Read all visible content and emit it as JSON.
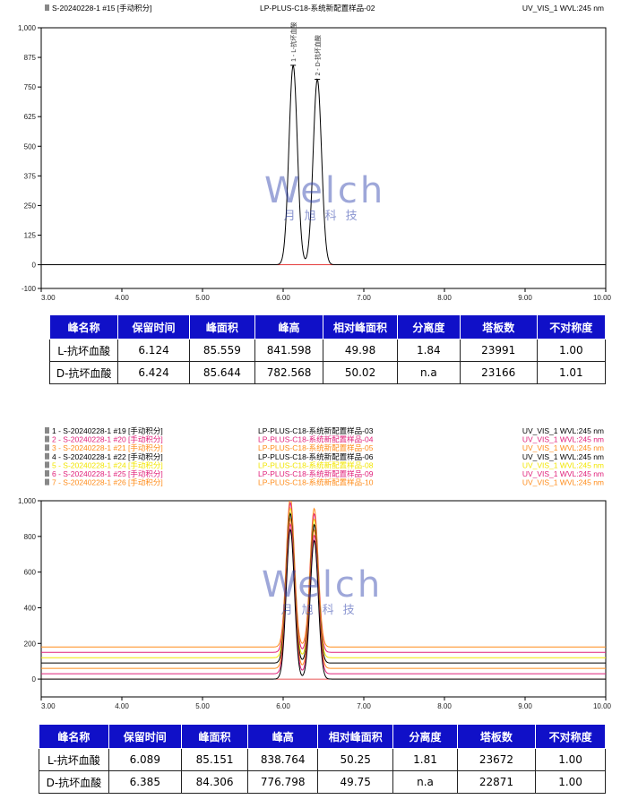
{
  "watermark": {
    "logo": "Welch",
    "subtitle": "月旭科技"
  },
  "colors": {
    "table_header_bg": "#1010c8",
    "baseline": "#e02020"
  },
  "panels": [
    {
      "header_rows": [
        {
          "color": "#000000",
          "left": "S-20240228-1 #15 [手动积分]",
          "mid": "LP-PLUS-C18-系统新配置样品-02",
          "right": "UV_VIS_1 WVL:245 nm"
        }
      ],
      "table": {
        "columns": [
          "峰名称",
          "保留时间",
          "峰面积",
          "峰高",
          "相对峰面积",
          "分离度",
          "塔板数",
          "不对称度"
        ],
        "rows": [
          [
            "L-抗坏血酸",
            "6.124",
            "85.559",
            "841.598",
            "49.98",
            "1.84",
            "23991",
            "1.00"
          ],
          [
            "D-抗坏血酸",
            "6.424",
            "85.644",
            "782.568",
            "50.02",
            "n.a",
            "23166",
            "1.01"
          ]
        ]
      }
    },
    {
      "header_rows": [
        {
          "color": "#000000",
          "left": "1 - S-20240228-1 #19 [手动积分]",
          "mid": "LP-PLUS-C18-系统新配置样品-03",
          "right": "UV_VIS_1 WVL:245 nm"
        },
        {
          "color": "#e0207a",
          "left": "2 - S-20240228-1 #20 [手动积分]",
          "mid": "LP-PLUS-C18-系统新配置样品-04",
          "right": "UV_VIS_1 WVL:245 nm"
        },
        {
          "color": "#ff8c1a",
          "left": "3 - S-20240228-1 #21 [手动积分]",
          "mid": "LP-PLUS-C18-系统新配置样品-05",
          "right": "UV_VIS_1 WVL:245 nm"
        },
        {
          "color": "#000000",
          "left": "4 - S-20240228-1 #22 [手动积分]",
          "mid": "LP-PLUS-C18-系统新配置样品-06",
          "right": "UV_VIS_1 WVL:245 nm"
        },
        {
          "color": "#f2e600",
          "left": "5 - S-20240228-1 #24 [手动积分]",
          "mid": "LP-PLUS-C18-系统新配置样品-08",
          "right": "UV_VIS_1 WVL:245 nm"
        },
        {
          "color": "#e0207a",
          "left": "6 - S-20240228-1 #25 [手动积分]",
          "mid": "LP-PLUS-C18-系统新配置样品-09",
          "right": "UV_VIS_1 WVL:245 nm"
        },
        {
          "color": "#ff8c1a",
          "left": "7 - S-20240228-1 #26 [手动积分]",
          "mid": "LP-PLUS-C18-系统新配置样品-10",
          "right": "UV_VIS_1 WVL:245 nm"
        }
      ],
      "table": {
        "columns": [
          "峰名称",
          "保留时间",
          "峰面积",
          "峰高",
          "相对峰面积",
          "分离度",
          "塔板数",
          "不对称度"
        ],
        "rows": [
          [
            "L-抗坏血酸",
            "6.089",
            "85.151",
            "838.764",
            "50.25",
            "1.81",
            "23672",
            "1.00"
          ],
          [
            "D-抗坏血酸",
            "6.385",
            "84.306",
            "776.798",
            "49.75",
            "n.a",
            "22871",
            "1.00"
          ]
        ]
      }
    }
  ],
  "chart_data": [
    {
      "type": "line",
      "title": "LP-PLUS-C18-系统新配置样品-02",
      "xlim": [
        3.0,
        10.0
      ],
      "ylim": [
        -100,
        1000
      ],
      "xticks": [
        "3.00",
        "4.00",
        "5.00",
        "6.00",
        "7.00",
        "8.00",
        "9.00",
        "10.00"
      ],
      "yticks": [
        "1,000",
        "875",
        "750",
        "625",
        "500",
        "375",
        "250",
        "125",
        "0",
        "-100"
      ],
      "ytick_values": [
        1000,
        875,
        750,
        625,
        500,
        375,
        250,
        125,
        0,
        -100
      ],
      "peak_labels": [
        "1 - L-抗坏血酸",
        "2 - D-抗坏血酸"
      ],
      "series": [
        {
          "name": "S-20240228-1 #15",
          "color": "#000000",
          "offset": 0,
          "peaks": [
            {
              "rt": 6.124,
              "height": 841.598
            },
            {
              "rt": 6.424,
              "height": 782.568
            }
          ]
        }
      ]
    },
    {
      "type": "line",
      "title": "",
      "xlim": [
        3.0,
        10.0
      ],
      "ylim": [
        -100,
        1000
      ],
      "xticks": [
        "3.00",
        "4.00",
        "5.00",
        "6.00",
        "7.00",
        "8.00",
        "9.00",
        "10.00"
      ],
      "yticks": [
        "1,000",
        "800",
        "600",
        "400",
        "200",
        "0"
      ],
      "ytick_values": [
        1000,
        800,
        600,
        400,
        200,
        0
      ],
      "series": [
        {
          "name": "1 - S-20240228-1 #19",
          "color": "#000000",
          "offset": 0,
          "peaks": [
            {
              "rt": 6.089,
              "height": 838.764
            },
            {
              "rt": 6.385,
              "height": 776.798
            }
          ]
        },
        {
          "name": "2 - S-20240228-1 #20",
          "color": "#e0207a",
          "offset": 30,
          "peaks": [
            {
              "rt": 6.089,
              "height": 838.764
            },
            {
              "rt": 6.385,
              "height": 776.798
            }
          ]
        },
        {
          "name": "3 - S-20240228-1 #21",
          "color": "#ff8c1a",
          "offset": 60,
          "peaks": [
            {
              "rt": 6.089,
              "height": 838.764
            },
            {
              "rt": 6.385,
              "height": 776.798
            }
          ]
        },
        {
          "name": "4 - S-20240228-1 #22",
          "color": "#000000",
          "offset": 90,
          "peaks": [
            {
              "rt": 6.089,
              "height": 838.764
            },
            {
              "rt": 6.385,
              "height": 776.798
            }
          ]
        },
        {
          "name": "5 - S-20240228-1 #24",
          "color": "#f2e600",
          "offset": 120,
          "peaks": [
            {
              "rt": 6.089,
              "height": 838.764
            },
            {
              "rt": 6.385,
              "height": 776.798
            }
          ]
        },
        {
          "name": "6 - S-20240228-1 #25",
          "color": "#e0207a",
          "offset": 150,
          "peaks": [
            {
              "rt": 6.089,
              "height": 838.764
            },
            {
              "rt": 6.385,
              "height": 776.798
            }
          ]
        },
        {
          "name": "7 - S-20240228-1 #26",
          "color": "#ff8c1a",
          "offset": 180,
          "peaks": [
            {
              "rt": 6.089,
              "height": 838.764
            },
            {
              "rt": 6.385,
              "height": 776.798
            }
          ]
        }
      ]
    }
  ]
}
